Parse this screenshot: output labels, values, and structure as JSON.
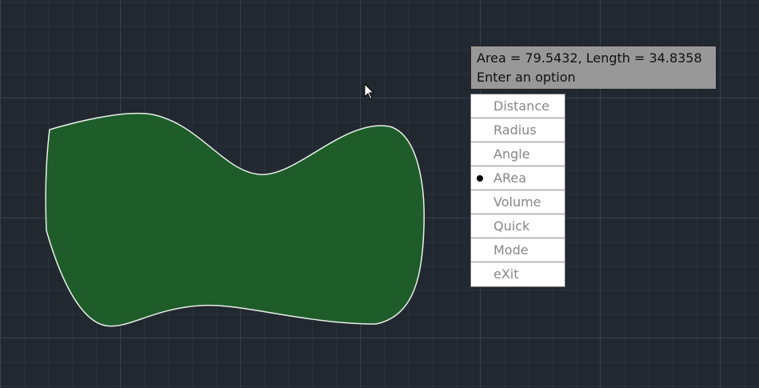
{
  "tooltip": {
    "line1": "Area = 79.5432, Length = 34.8358",
    "line2": "Enter an option"
  },
  "menu": {
    "items": [
      {
        "label": "Distance",
        "selected": false
      },
      {
        "label": "Radius",
        "selected": false
      },
      {
        "label": "Angle",
        "selected": false
      },
      {
        "label": "ARea",
        "selected": true
      },
      {
        "label": "Volume",
        "selected": false
      },
      {
        "label": "Quick",
        "selected": false
      },
      {
        "label": "Mode",
        "selected": false
      },
      {
        "label": "eXit",
        "selected": false
      }
    ]
  },
  "colors": {
    "background": "#212830",
    "region_fill": "#1e5c2a",
    "region_outline": "#e8f0e8",
    "tooltip_bg": "#989898",
    "menu_text": "#868686"
  }
}
